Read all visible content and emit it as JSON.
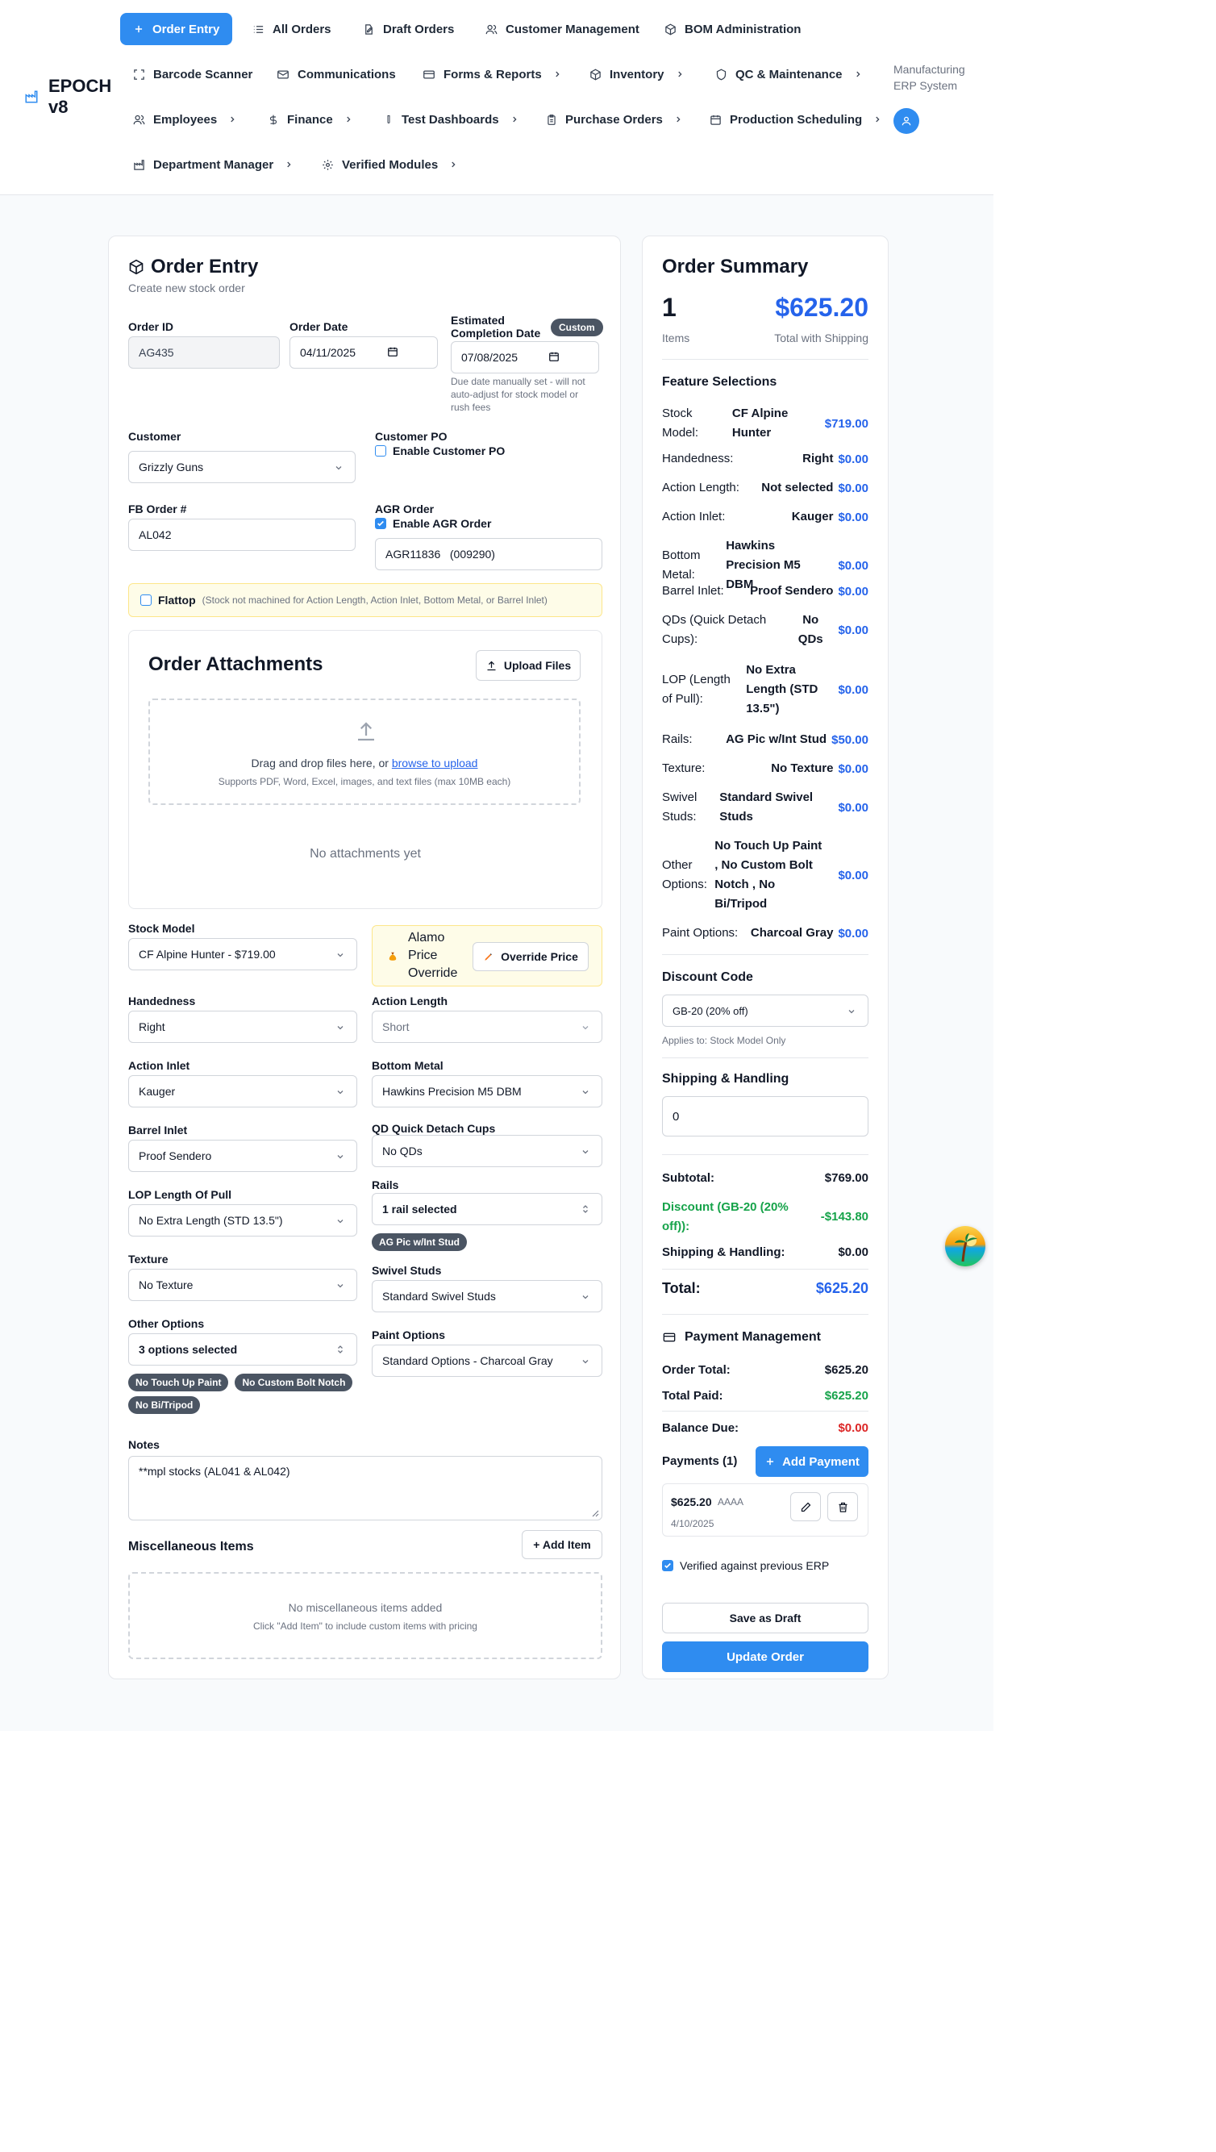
{
  "app": {
    "name": "EPOCH v8",
    "system_label": "Manufacturing ERP System"
  },
  "nav": {
    "row1": [
      "Order Entry",
      "All Orders",
      "Draft Orders",
      "Customer Management",
      "BOM Administration"
    ],
    "row2": [
      "Barcode Scanner",
      "Communications",
      "Forms & Reports",
      "Inventory",
      "QC & Maintenance"
    ],
    "row3": [
      "Employees",
      "Finance",
      "Test Dashboards",
      "Purchase Orders",
      "Production Scheduling"
    ],
    "row4": [
      "Department Manager",
      "Verified Modules"
    ]
  },
  "order_form": {
    "title": "Order Entry",
    "subtitle": "Create new stock order",
    "order_id": {
      "label": "Order ID",
      "value": "AG435"
    },
    "order_date": {
      "label": "Order Date",
      "value": "04/11/2025"
    },
    "completion": {
      "label": "Estimated Completion Date",
      "badge": "Custom",
      "value": "07/08/2025",
      "note": "Due date manually set - will not auto-adjust for stock model or rush fees"
    },
    "customer": {
      "label": "Customer",
      "value": "Grizzly Guns"
    },
    "customer_po": {
      "label": "Customer PO",
      "checkbox": "Enable Customer PO"
    },
    "fb_order": {
      "label": "FB Order #",
      "value": "AL042"
    },
    "agr_order": {
      "label": "AGR Order",
      "checkbox": "Enable AGR Order",
      "value": "AGR11836   (009290)"
    },
    "flattop": {
      "label": "Flattop",
      "note": "(Stock not machined for Action Length, Action Inlet, Bottom Metal, or Barrel Inlet)"
    },
    "attachments": {
      "title": "Order Attachments",
      "upload_button": "Upload Files",
      "drop_text": "Drag and drop files here, or",
      "drop_link": "browse to upload",
      "supports": "Supports PDF, Word, Excel, images, and text files (max 10MB each)",
      "empty": "No attachments yet"
    },
    "stock_model": {
      "label": "Stock Model",
      "value": "CF Alpine Hunter - $719.00"
    },
    "price_override": {
      "label": "Alamo Price Override",
      "button": "Override Price"
    },
    "handedness": {
      "label": "Handedness",
      "value": "Right"
    },
    "action_length": {
      "label": "Action Length",
      "value": "Short"
    },
    "action_inlet": {
      "label": "Action Inlet",
      "value": "Kauger"
    },
    "bottom_metal": {
      "label": "Bottom Metal",
      "value": "Hawkins Precision M5 DBM"
    },
    "barrel_inlet": {
      "label": "Barrel Inlet",
      "value": "Proof Sendero"
    },
    "qd_cups": {
      "label": "QD Quick Detach Cups",
      "value": "No QDs"
    },
    "lop": {
      "label": "LOP Length Of Pull",
      "value": "No Extra Length (STD 13.5\")"
    },
    "rails": {
      "label": "Rails",
      "value": "1 rail selected",
      "chips": [
        "AG Pic w/Int Stud"
      ]
    },
    "texture": {
      "label": "Texture",
      "value": "No Texture"
    },
    "swivel_studs": {
      "label": "Swivel Studs",
      "value": "Standard Swivel Studs"
    },
    "other_options": {
      "label": "Other Options",
      "value": "3 options selected",
      "chips": [
        "No Touch Up Paint",
        "No Custom Bolt Notch",
        "No Bi/Tripod"
      ]
    },
    "paint_options": {
      "label": "Paint Options",
      "value": "Standard Options - Charcoal Gray"
    },
    "notes": {
      "label": "Notes",
      "value": "**mpl stocks (AL041 & AL042)"
    },
    "misc": {
      "title": "Miscellaneous Items",
      "button": "+ Add Item",
      "empty": "No miscellaneous items added",
      "hint": "Click \"Add Item\" to include custom items with pricing"
    }
  },
  "summary": {
    "title": "Order Summary",
    "items_count": "1",
    "items_label": "Items",
    "total": "$625.20",
    "total_label": "Total with Shipping",
    "features_title": "Feature Selections",
    "features": [
      {
        "key": "Stock Model:",
        "value": "CF Alpine Hunter",
        "price": "$719.00"
      },
      {
        "key": "Handedness:",
        "value": "Right",
        "price": "$0.00"
      },
      {
        "key": "Action Length:",
        "value": "Not selected",
        "price": "$0.00"
      },
      {
        "key": "Action Inlet:",
        "value": "Kauger",
        "price": "$0.00"
      },
      {
        "key": "Bottom Metal:",
        "value": "Hawkins Precision M5 DBM",
        "price": "$0.00"
      },
      {
        "key": "Barrel Inlet:",
        "value": "Proof Sendero",
        "price": "$0.00"
      },
      {
        "key": "QDs (Quick Detach Cups):",
        "value": "No QDs",
        "price": "$0.00"
      },
      {
        "key": "LOP (Length of Pull):",
        "value": "No Extra Length (STD 13.5\")",
        "price": "$0.00"
      },
      {
        "key": "Rails:",
        "value": "AG Pic w/Int Stud",
        "price": "$50.00"
      },
      {
        "key": "Texture:",
        "value": "No Texture",
        "price": "$0.00"
      },
      {
        "key": "Swivel Studs:",
        "value": "Standard Swivel Studs",
        "price": "$0.00"
      },
      {
        "key": "Other Options:",
        "value": "No Touch Up Paint , No Custom Bolt Notch , No Bi/Tripod",
        "price": "$0.00"
      },
      {
        "key": "Paint Options:",
        "value": "Charcoal Gray",
        "price": "$0.00"
      }
    ],
    "discount": {
      "label": "Discount Code",
      "value": "GB-20 (20% off)",
      "note": "Applies to: Stock Model Only"
    },
    "shipping": {
      "label": "Shipping & Handling",
      "value": "0"
    },
    "totals": {
      "subtotal_label": "Subtotal:",
      "subtotal": "$769.00",
      "discount_label": "Discount (GB-20 (20% off)):",
      "discount": "-$143.80",
      "shipping_label": "Shipping & Handling:",
      "shipping": "$0.00",
      "total_label": "Total:",
      "total": "$625.20"
    },
    "payment": {
      "title": "Payment Management",
      "order_total_label": "Order Total:",
      "order_total": "$625.20",
      "total_paid_label": "Total Paid:",
      "total_paid": "$625.20",
      "balance_label": "Balance Due:",
      "balance": "$0.00",
      "payments_label": "Payments (1)",
      "add_button": "Add Payment",
      "entry": {
        "amount": "$625.20",
        "method": "AAAA",
        "date": "4/10/2025"
      }
    },
    "verified": "Verified against previous ERP",
    "save_draft": "Save as Draft",
    "update": "Update Order"
  },
  "colors": {
    "accent": "#2f8cf0",
    "price_blue": "#2563eb",
    "green": "#16a34a",
    "red": "#dc2626"
  }
}
